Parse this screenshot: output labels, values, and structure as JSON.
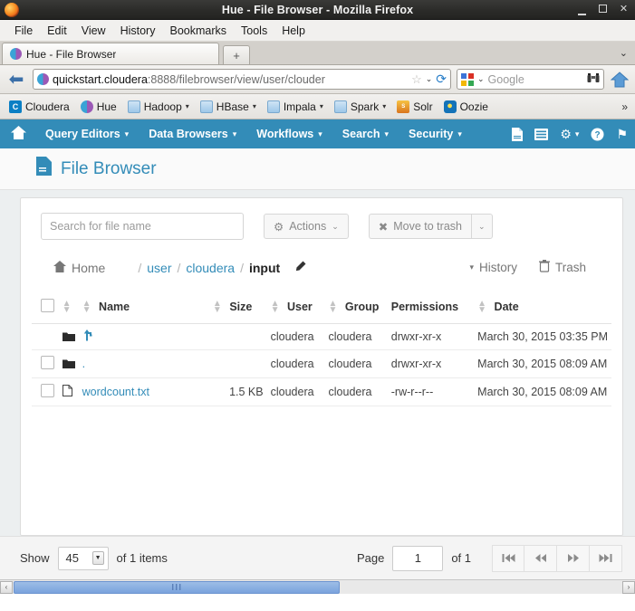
{
  "window": {
    "title": "Hue - File Browser - Mozilla Firefox",
    "minimize_label": "_",
    "maximize_label": "□",
    "close_label": "✕"
  },
  "menubar": {
    "items": [
      "File",
      "Edit",
      "View",
      "History",
      "Bookmarks",
      "Tools",
      "Help"
    ]
  },
  "tabs": {
    "active_tab_title": "Hue - File Browser",
    "new_tab_label": "+",
    "list_all_tabs_label": "⌄"
  },
  "navtoolbar": {
    "back_label": "⬅",
    "url_host": "quickstart.cloudera",
    "url_rest": ":8888/filebrowser/view/user/clouder",
    "bookmark_star": "☆",
    "url_dropdown": "⌄",
    "reload_label": "⟳",
    "search_placeholder": "Google",
    "search_dropdown": "⌄",
    "binoculars_label": "👓",
    "home_label": "⌂"
  },
  "bookmarks": [
    {
      "label": "Cloudera",
      "icon": "cloudera-icon",
      "has_caret": false
    },
    {
      "label": "Hue",
      "icon": "hue-icon",
      "has_caret": false
    },
    {
      "label": "Hadoop",
      "icon": "folder-icon",
      "has_caret": true
    },
    {
      "label": "HBase",
      "icon": "folder-icon",
      "has_caret": true
    },
    {
      "label": "Impala",
      "icon": "folder-icon",
      "has_caret": true
    },
    {
      "label": "Spark",
      "icon": "folder-icon",
      "has_caret": true
    },
    {
      "label": "Solr",
      "icon": "solr-icon",
      "has_caret": false
    },
    {
      "label": "Oozie",
      "icon": "oozie-icon",
      "has_caret": false
    }
  ],
  "bookmarks_overflow_label": "»",
  "hue_nav": {
    "home_icon": "⌂",
    "items": [
      {
        "label": "Query Editors",
        "caret": "▾"
      },
      {
        "label": "Data Browsers",
        "caret": "▾"
      },
      {
        "label": "Workflows",
        "caret": "▾"
      },
      {
        "label": "Search",
        "caret": "▾"
      },
      {
        "label": "Security",
        "caret": "▾"
      }
    ],
    "right_icons": [
      {
        "name": "document-icon",
        "glyph": "🗋"
      },
      {
        "name": "list-icon",
        "glyph": "▤"
      },
      {
        "name": "settings-gear-icon",
        "glyph": "⚙",
        "caret": "▾"
      },
      {
        "name": "help-icon",
        "glyph": "?"
      },
      {
        "name": "flag-icon",
        "glyph": "⚑"
      }
    ]
  },
  "page": {
    "icon": "file-browser-icon",
    "title": "File Browser"
  },
  "toolbar": {
    "search_placeholder": "Search for file name",
    "search_value": "",
    "actions_label": "Actions",
    "actions_caret": "⌄",
    "move_to_trash_label": "Move to trash",
    "move_to_trash_icon": "✖",
    "move_to_trash_caret": "⌄"
  },
  "breadcrumb": {
    "home_label": "Home",
    "home_icon": "home-icon",
    "separator": "/",
    "parts": [
      {
        "label": "user",
        "current": false
      },
      {
        "label": "cloudera",
        "current": false
      },
      {
        "label": "input",
        "current": true
      }
    ],
    "edit_icon": "pencil-icon",
    "history_label": "History",
    "history_caret": "▾",
    "trash_label": "Trash",
    "trash_icon": "trash-icon"
  },
  "table": {
    "columns": [
      "Name",
      "Size",
      "User",
      "Group",
      "Permissions",
      "Date"
    ],
    "rows": [
      {
        "checkbox": false,
        "icon": "folder-icon",
        "name": "..",
        "name_glyph": "↱",
        "is_link": true,
        "size": "",
        "user": "cloudera",
        "group": "cloudera",
        "permissions": "drwxr-xr-x",
        "date": "March 30, 2015 03:35 PM"
      },
      {
        "checkbox": true,
        "icon": "folder-icon",
        "name": ".",
        "name_glyph": ".",
        "is_link": true,
        "size": "",
        "user": "cloudera",
        "group": "cloudera",
        "permissions": "drwxr-xr-x",
        "date": "March 30, 2015 08:09 AM"
      },
      {
        "checkbox": true,
        "icon": "file-icon",
        "name": "wordcount.txt",
        "name_glyph": "wordcount.txt",
        "is_link": true,
        "size": "1.5 KB",
        "user": "cloudera",
        "group": "cloudera",
        "permissions": "-rw-r--r--",
        "date": "March 30, 2015 08:09 AM"
      }
    ]
  },
  "footer": {
    "show_label": "Show",
    "page_size": "45",
    "of_items_label": "of 1 items",
    "page_label": "Page",
    "page_value": "1",
    "of_pages_label": "of 1",
    "first_page_icon": "⏮",
    "prev_page_icon": "⏪",
    "next_page_icon": "⏩",
    "last_page_icon": "⏭"
  },
  "scrollbar": {
    "left_arrow": "‹",
    "right_arrow": "›",
    "grip": "⋮⋮"
  },
  "colors": {
    "hue_blue": "#338cb8",
    "link_blue": "#338cb8",
    "panel_bg": "#eceff0"
  }
}
